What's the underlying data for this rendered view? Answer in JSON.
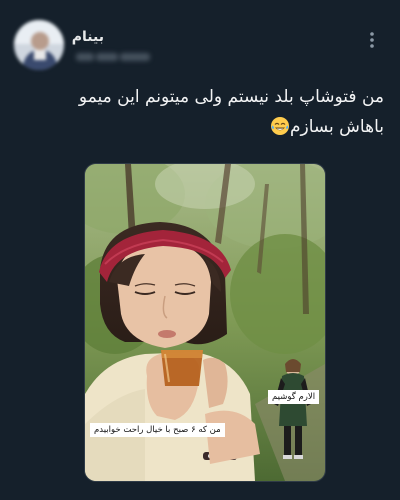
{
  "post": {
    "author": {
      "display_name": "بینام"
    },
    "text": "من فتوشاپ بلد نیستم ولی میتونم این میمو باهاش بسازم",
    "emoji": "smiling-face-with-tears-of-joy",
    "media": {
      "captions": {
        "alarm": "الارم گوشیم",
        "me": "من که ۶ صبح با خیال راحت خوابیدم"
      }
    }
  },
  "colors": {
    "background": "#15202b",
    "text": "#e7e9ea",
    "icon": "#8b98a5",
    "caption_bg": "#ffffff"
  },
  "icons": {
    "more": "more-vertical-icon"
  }
}
